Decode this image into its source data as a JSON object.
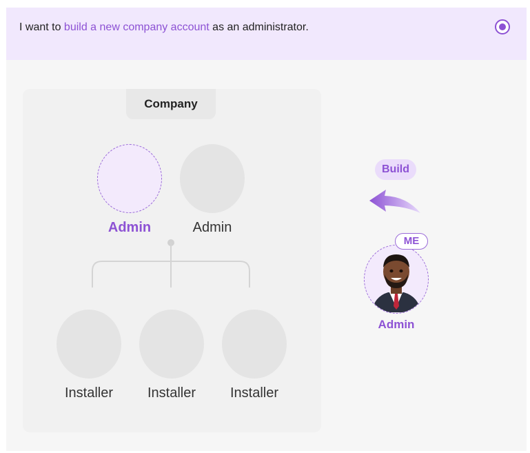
{
  "option": {
    "prefix": "I want to ",
    "highlight": "build a new company account",
    "suffix": " as an administrator.",
    "selected": true,
    "radio_icon": "radio-selected-icon"
  },
  "company": {
    "title": "Company",
    "admins": [
      {
        "label": "Admin",
        "state": "selected"
      },
      {
        "label": "Admin",
        "state": "default"
      }
    ],
    "installers": [
      {
        "label": "Installer"
      },
      {
        "label": "Installer"
      },
      {
        "label": "Installer"
      }
    ]
  },
  "me": {
    "action_label": "Build",
    "badge": "ME",
    "role": "Admin",
    "arrow_icon": "curved-arrow-left-icon",
    "avatar_icon": "user-avatar-icon"
  },
  "colors": {
    "accent": "#8d52d4",
    "accent_light": "#f1e8fd",
    "card_bg": "#f1f1f1",
    "placeholder": "#e4e4e4"
  }
}
